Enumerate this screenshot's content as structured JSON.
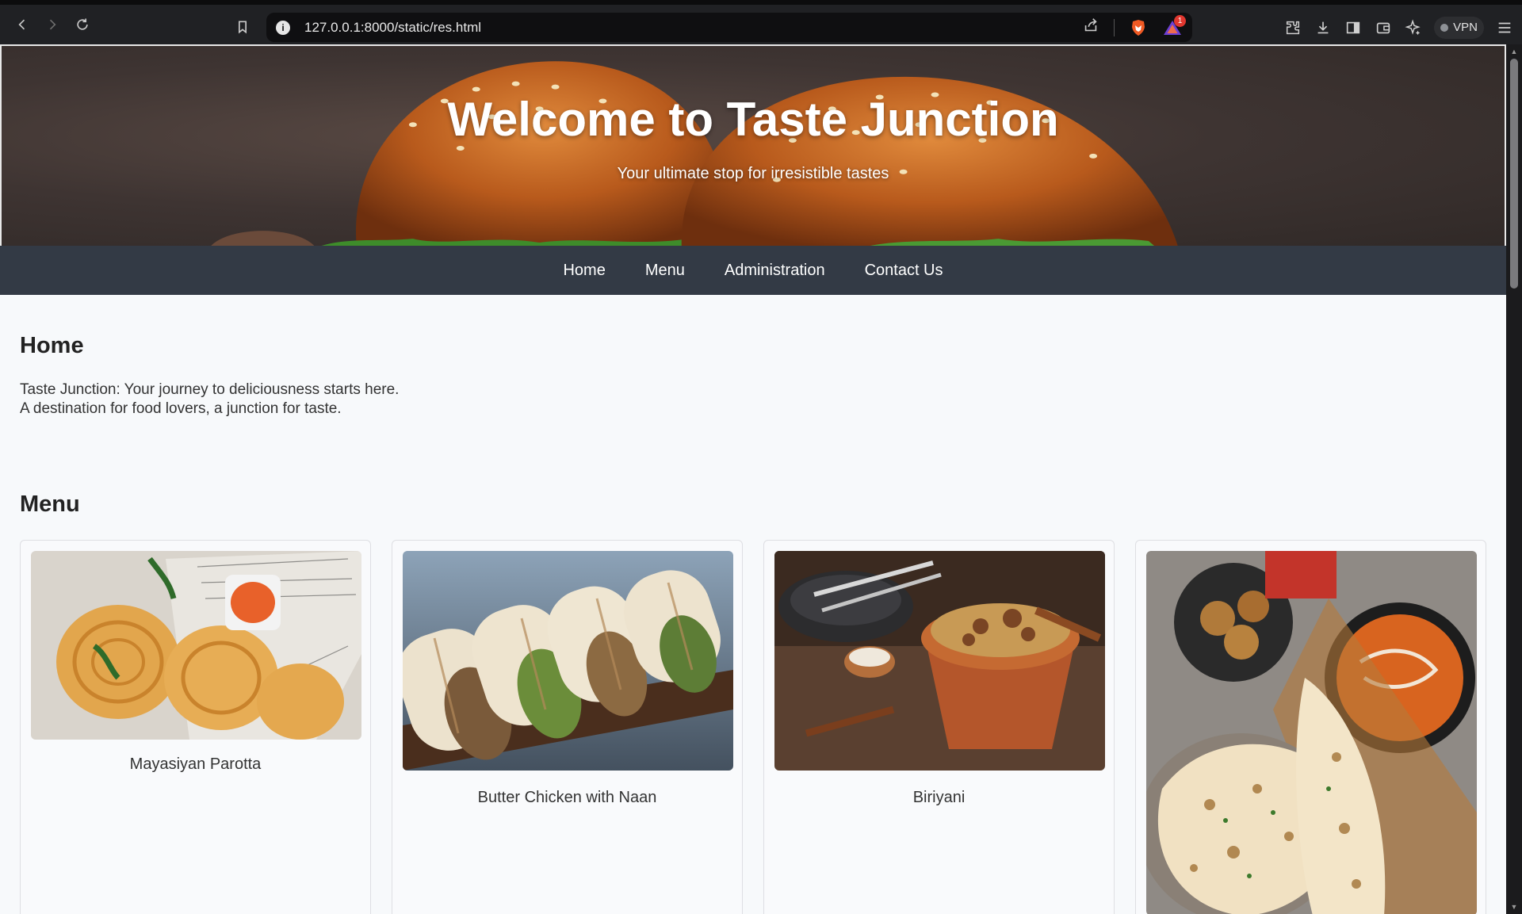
{
  "browser": {
    "url": "127.0.0.1:8000/static/res.html",
    "rewards_badge": "1",
    "vpn_label": "VPN"
  },
  "hero": {
    "title": "Welcome to Taste Junction",
    "subtitle": "Your ultimate stop for irresistible tastes"
  },
  "nav": {
    "items": [
      "Home",
      "Menu",
      "Administration",
      "Contact Us"
    ]
  },
  "home": {
    "heading": "Home",
    "line1": "Taste Junction: Your journey to deliciousness starts here.",
    "line2": "A destination for food lovers, a junction for taste."
  },
  "menu": {
    "heading": "Menu",
    "items": [
      {
        "name": "Mayasiyan Parotta"
      },
      {
        "name": "Butter Chicken with Naan"
      },
      {
        "name": "Biriyani"
      },
      {
        "name": ""
      }
    ]
  },
  "colors": {
    "nav_bg": "#333a45",
    "page_bg": "#f7f9fb"
  }
}
